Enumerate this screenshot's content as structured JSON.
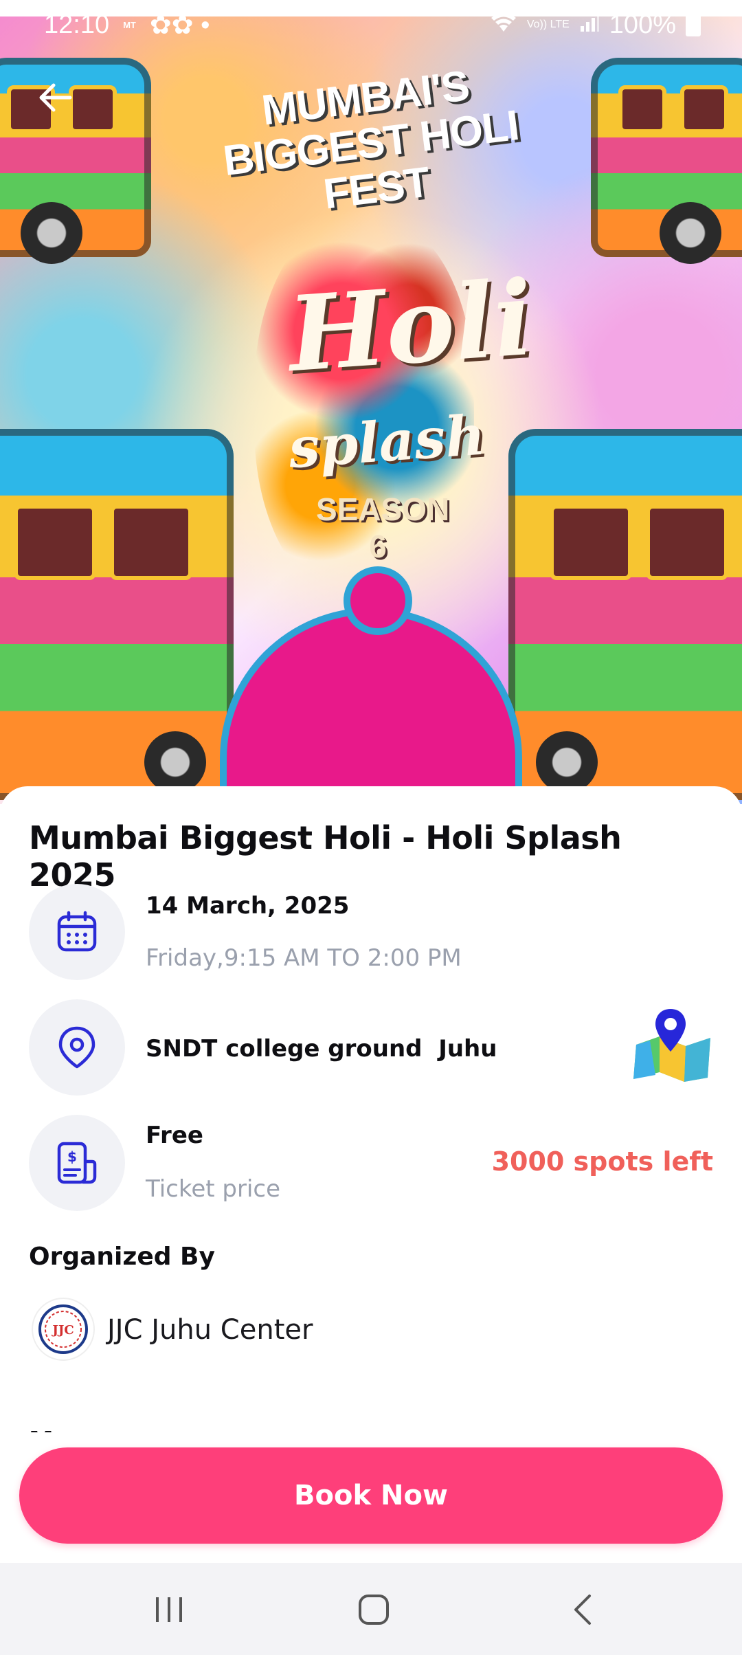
{
  "status_bar": {
    "time": "12:10",
    "carrier_tag": "MT",
    "net_label": "Vo)) LTE",
    "battery": "100%"
  },
  "banner": {
    "headline": "MUMBAI'S BIGGEST HOLI FEST",
    "logo_line1": "Holi",
    "logo_line2": "splash",
    "logo_line3": "SEASON 6"
  },
  "event": {
    "title": "Mumbai Biggest Holi - Holi Splash 2025",
    "date": "14 March, 2025",
    "day_time": "Friday,9:15 AM TO 2:00 PM",
    "location": "SNDT college ground  Juhu",
    "price": "Free",
    "price_label": "Ticket price",
    "spots_left": "3000 spots left"
  },
  "organizer": {
    "heading": "Organized By",
    "name": "JJC Juhu Center",
    "logo_text": "JJC"
  },
  "partial_heading": "M",
  "actions": {
    "book_label": "Book Now"
  },
  "colors": {
    "accent": "#fe3f7a",
    "icon_blue": "#2b2bd6",
    "spots_red": "#f0605a",
    "muted_text": "#9aa0ad"
  },
  "icons": {
    "back": "arrow-left-icon",
    "date": "calendar-icon",
    "location": "location-pin-icon",
    "map": "map-icon",
    "price": "receipt-icon"
  }
}
